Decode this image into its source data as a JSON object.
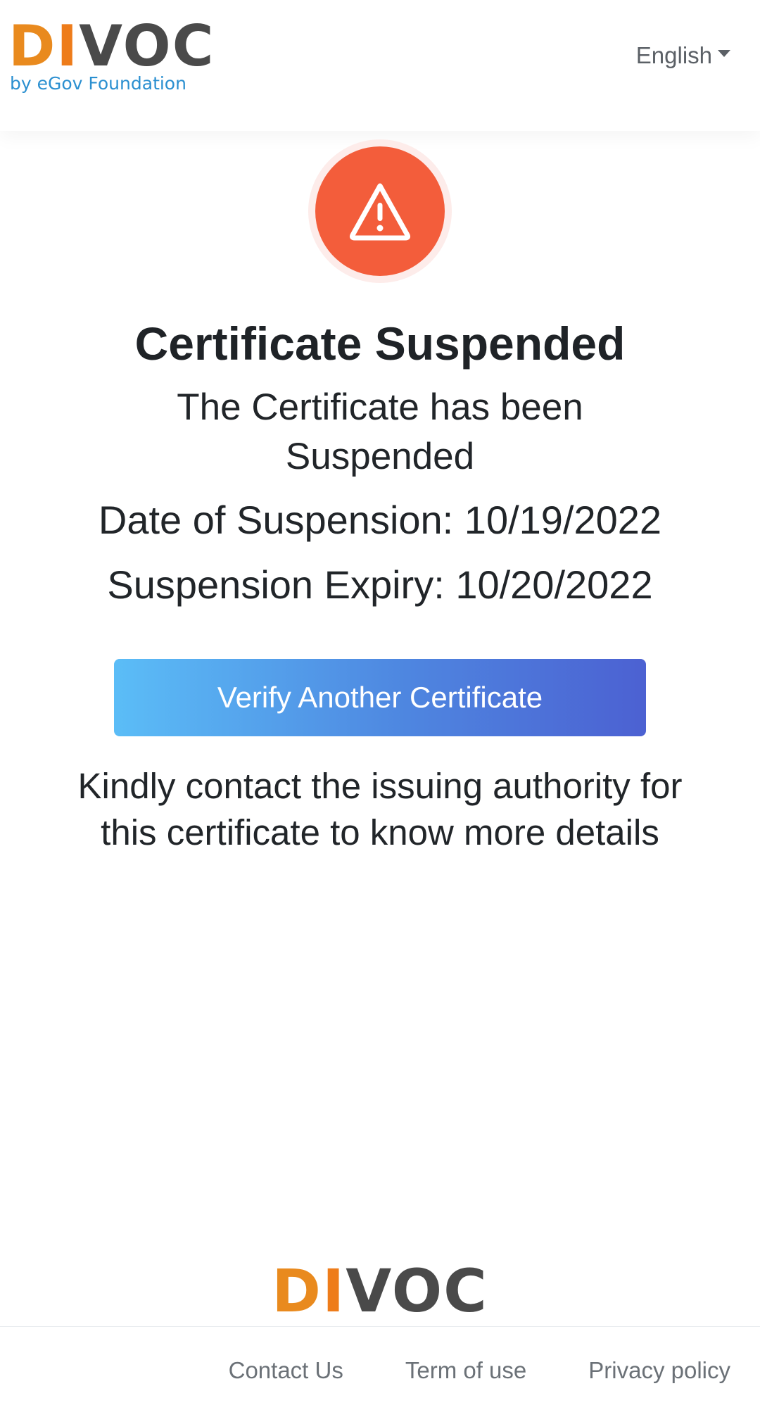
{
  "header": {
    "logo_text": "DIVOC",
    "logo_subtext": "by eGov Foundation",
    "language_selected": "English"
  },
  "status": {
    "icon": "warning-triangle-icon",
    "color": "#f35d3b"
  },
  "main": {
    "title": "Certificate Suspended",
    "message": "The Certificate has been Suspended",
    "date_of_suspension": "Date of Suspension: 10/19/2022",
    "suspension_expiry": "Suspension Expiry: 10/20/2022",
    "verify_button_label": "Verify Another Certificate",
    "note": "Kindly contact the issuing authority for this certificate to know more details"
  },
  "footer": {
    "logo_text": "DIVOC",
    "links": [
      "Contact Us",
      "Term of use",
      "Privacy policy"
    ]
  },
  "colors": {
    "brand_orange": "#e98a1e",
    "brand_gray": "#4a4a4a",
    "button_gradient_start": "#5bbdf7",
    "button_gradient_end": "#4c61d2"
  }
}
